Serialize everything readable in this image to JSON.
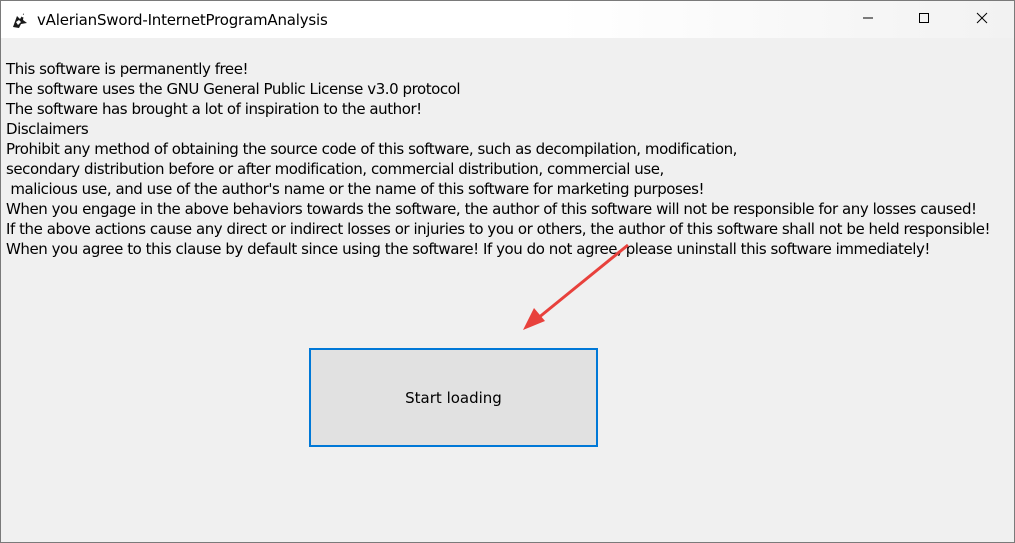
{
  "window": {
    "title": "vAlerianSword-InternetProgramAnalysis",
    "app_icon": "app-icon"
  },
  "controls": {
    "minimize_icon": "minimize-icon",
    "maximize_icon": "maximize-icon",
    "close_icon": "close-icon"
  },
  "content": {
    "lines": [
      "This software is permanently free!",
      "The software uses the GNU General Public License v3.0 protocol",
      "The software has brought a lot of inspiration to the author!",
      "Disclaimers",
      "Prohibit any method of obtaining the source code of this software, such as decompilation, modification,",
      "secondary distribution before or after modification, commercial distribution, commercial use,",
      " malicious use, and use of the author's name or the name of this software for marketing purposes!",
      "When you engage in the above behaviors towards the software, the author of this software will not be responsible for any losses caused!",
      "If the above actions cause any direct or indirect losses or injuries to you or others, the author of this software shall not be held responsible!",
      "When you agree to this clause by default since using the software! If you do not agree, please uninstall this software immediately!"
    ]
  },
  "start_button": {
    "label": "Start loading"
  },
  "annotation": {
    "arrow_color": "#e8413c"
  }
}
